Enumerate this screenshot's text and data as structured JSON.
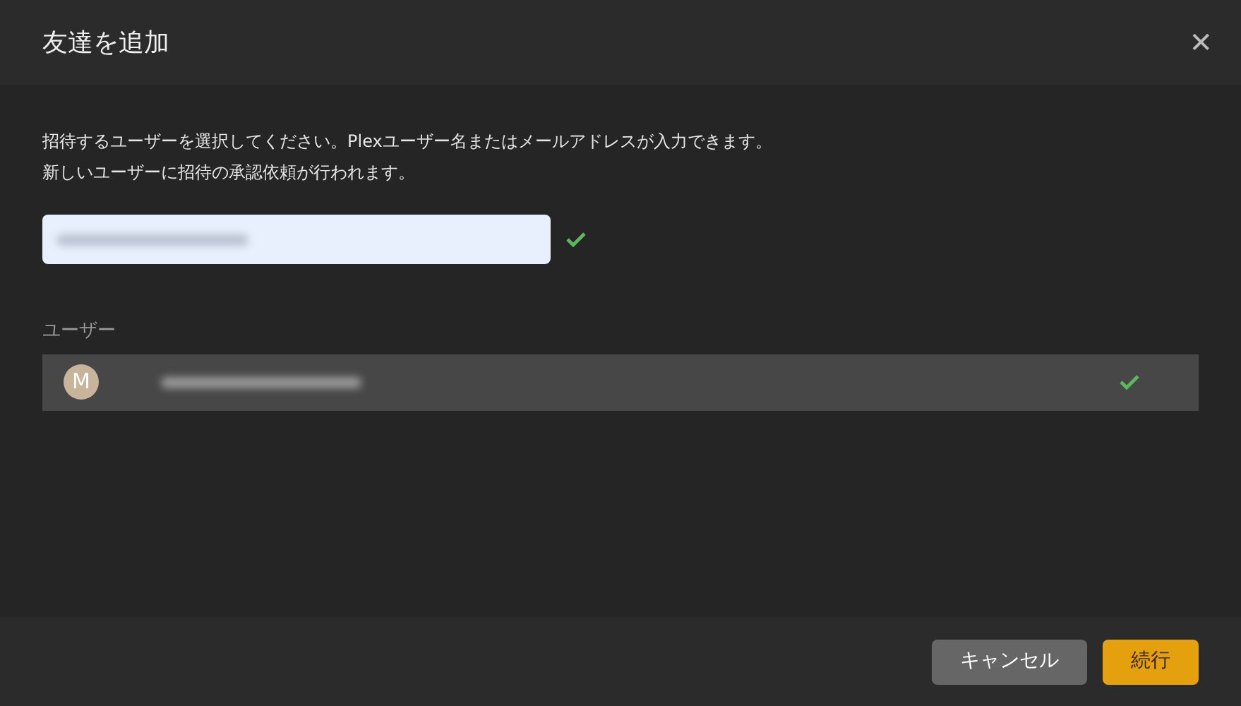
{
  "dialog": {
    "title": "友達を追加",
    "close_icon": "✕"
  },
  "instructions": [
    "招待するユーザーを選択してください。Plexユーザー名またはメールアドレスが入力できます。",
    "新しいユーザーに招待の承認依頼が行われます。"
  ],
  "email_field": {
    "valid": true
  },
  "users_section": {
    "label": "ユーザー",
    "users": [
      {
        "initial": "M",
        "selected": true
      }
    ]
  },
  "buttons": [
    {
      "label": "キャンセル",
      "kind": "secondary"
    },
    {
      "label": "続行",
      "kind": "primary"
    }
  ]
}
